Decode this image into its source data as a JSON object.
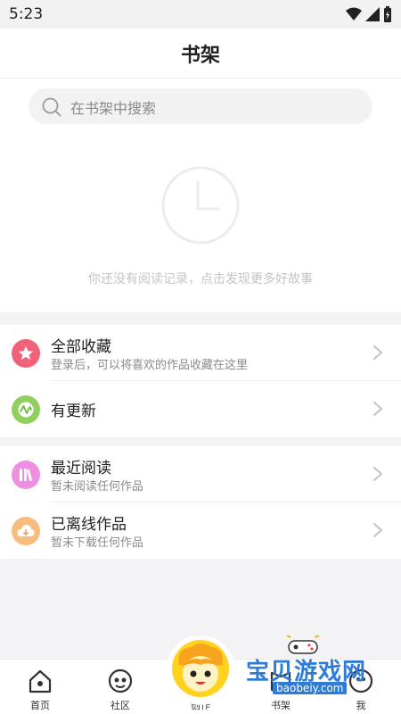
{
  "status_bar": {
    "time": "5:23"
  },
  "header": {
    "title": "书架"
  },
  "search": {
    "placeholder": "在书架中搜索"
  },
  "empty_state": {
    "message": "你还没有阅读记录，点击发现更多好故事"
  },
  "sections": [
    {
      "rows": [
        {
          "title": "全部收藏",
          "subtitle": "登录后，可以将喜欢的作品收藏在这里",
          "icon": "star-icon",
          "color": "#f0627a"
        },
        {
          "title": "有更新",
          "subtitle": "",
          "icon": "update-icon",
          "color": "#8fd05f"
        }
      ]
    },
    {
      "rows": [
        {
          "title": "最近阅读",
          "subtitle": "暂未阅读任何作品",
          "icon": "books-icon",
          "color": "#ee8fe2"
        },
        {
          "title": "已离线作品",
          "subtitle": "暂未下载任何作品",
          "icon": "cloud-download-icon",
          "color": "#f7bd7c"
        }
      ]
    }
  ],
  "tabbar": {
    "items": [
      {
        "label": "首页",
        "icon": "home-icon"
      },
      {
        "label": "社区",
        "icon": "community-icon"
      },
      {
        "label": "创作",
        "icon": "create-mascot-icon"
      },
      {
        "label": "书架",
        "icon": "bookshelf-icon"
      },
      {
        "label": "我",
        "icon": "profile-icon"
      }
    ]
  },
  "watermark": {
    "text": "宝贝游戏网",
    "url": "baobeiy.com"
  }
}
